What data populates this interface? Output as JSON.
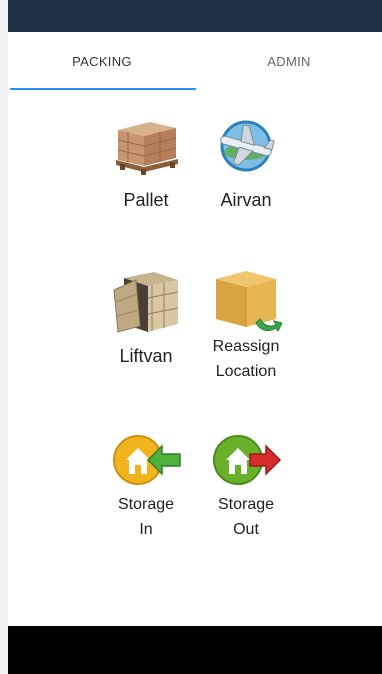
{
  "tabs": [
    {
      "label": "PACKING",
      "active": true
    },
    {
      "label": "ADMIN",
      "active": false
    }
  ],
  "tiles": [
    {
      "icon": "pallet-icon",
      "line1": "Pallet",
      "line2": ""
    },
    {
      "icon": "airplane-icon",
      "line1": "Airvan",
      "line2": ""
    },
    {
      "icon": "liftvan-crate-icon",
      "line1": "Liftvan",
      "line2": ""
    },
    {
      "icon": "box-arrow-icon",
      "line1": "Reassign",
      "line2": "Location"
    },
    {
      "icon": "house-arrow-in-icon",
      "line1": "Storage",
      "line2": "In"
    },
    {
      "icon": "house-arrow-out-icon",
      "line1": "Storage",
      "line2": "Out"
    }
  ],
  "colors": {
    "status_bar": "#1e2e45",
    "tab_indicator": "#2196f3",
    "storage_in_circle": "#f2b41c",
    "storage_out_circle": "#6ab02b"
  }
}
